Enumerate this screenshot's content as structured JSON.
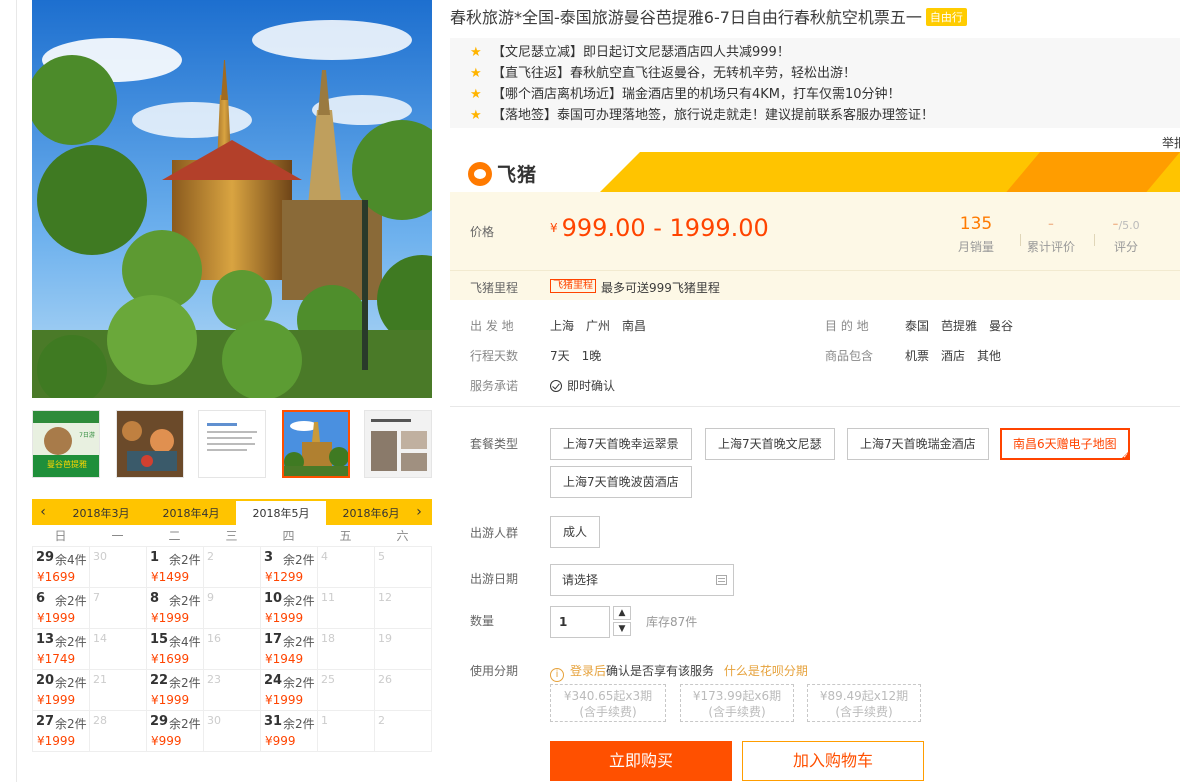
{
  "product": {
    "title": "春秋旅游*全国-泰国旅游曼谷芭提雅6-7日自由行春秋航空机票五一",
    "badge": "自由行"
  },
  "highlights": [
    "【文尼瑟立减】即日起订文尼瑟酒店四人共减999！",
    "【直飞往返】春秋航空直飞往返曼谷，无转机辛劳，轻松出游！",
    "【哪个酒店离机场近】瑞金酒店里的机场只有4KM，打车仅需10分钟！",
    "【落地签】泰国可办理落地签，旅行说走就走！建议提前联系客服办理签证！"
  ],
  "report_text": "举报",
  "brand": {
    "name": "飞猪",
    "colors": {
      "yellow": "#ffc400",
      "orange": "#ff9d00",
      "accent": "#ff5000"
    }
  },
  "price": {
    "label": "价格",
    "currency": "¥",
    "range": "999.00 - 1999.00"
  },
  "stats": [
    {
      "value": "135",
      "label": "月销量"
    },
    {
      "value": "-",
      "label": "累计评价"
    },
    {
      "value": "-",
      "suffix": "/5.0",
      "label": "评分"
    }
  ],
  "mileage": {
    "label": "飞猪里程",
    "tag": "飞猪里程",
    "text": "最多可送999飞猪里程"
  },
  "info": {
    "departure_label": "出 发 地",
    "departures": [
      "上海",
      "广州",
      "南昌"
    ],
    "destination_label": "目 的 地",
    "destinations": [
      "泰国",
      "芭提雅",
      "曼谷"
    ],
    "days_label": "行程天数",
    "days": [
      "7天",
      "1晚"
    ],
    "includes_label": "商品包含",
    "includes": [
      "机票",
      "酒店",
      "其他"
    ],
    "service_label": "服务承诺",
    "service": "即时确认"
  },
  "sku": {
    "package_label": "套餐类型",
    "packages": [
      "上海7天首晚幸运翠景",
      "上海7天首晚文尼瑟",
      "上海7天首晚瑞金酒店",
      "南昌6天赠电子地图",
      "上海7天首晚波茵酒店"
    ],
    "selected_index": 3,
    "crowd_label": "出游人群",
    "crowd": "成人",
    "date_label": "出游日期",
    "date_placeholder": "请选择",
    "qty_label": "数量",
    "qty": "1",
    "stock": "库存87件",
    "installment_label": "使用分期",
    "installment_login": "登录后",
    "installment_mid": "确认是否享有该服务",
    "installment_link": "什么是花呗分期",
    "installments": [
      {
        "line1": "¥340.65起x3期",
        "line2": "(含手续费)"
      },
      {
        "line1": "¥173.99起x6期",
        "line2": "(含手续费)"
      },
      {
        "line1": "¥89.49起x12期",
        "line2": "(含手续费)"
      }
    ],
    "buy": "立即购买",
    "cart": "加入购物车"
  },
  "calendar": {
    "prev": "‹",
    "next": "›",
    "months": [
      "2018年3月",
      "2018年4月",
      "2018年5月",
      "2018年6月"
    ],
    "active_month": 2,
    "weekdays": [
      "日",
      "一",
      "二",
      "三",
      "四",
      "五",
      "六"
    ],
    "cells": [
      {
        "d": "29",
        "s": "余4件",
        "p": "¥1699"
      },
      {
        "d": "30"
      },
      {
        "d": "1",
        "s": "余2件",
        "p": "¥1499"
      },
      {
        "d": "2"
      },
      {
        "d": "3",
        "s": "余2件",
        "p": "¥1299"
      },
      {
        "d": "4"
      },
      {
        "d": "5"
      },
      {
        "d": "6",
        "s": "余2件",
        "p": "¥1999"
      },
      {
        "d": "7"
      },
      {
        "d": "8",
        "s": "余2件",
        "p": "¥1999"
      },
      {
        "d": "9"
      },
      {
        "d": "10",
        "s": "余2件",
        "p": "¥1999"
      },
      {
        "d": "11"
      },
      {
        "d": "12"
      },
      {
        "d": "13",
        "s": "余2件",
        "p": "¥1749"
      },
      {
        "d": "14"
      },
      {
        "d": "15",
        "s": "余4件",
        "p": "¥1699"
      },
      {
        "d": "16"
      },
      {
        "d": "17",
        "s": "余2件",
        "p": "¥1949"
      },
      {
        "d": "18"
      },
      {
        "d": "19"
      },
      {
        "d": "20",
        "s": "余2件",
        "p": "¥1999"
      },
      {
        "d": "21"
      },
      {
        "d": "22",
        "s": "余2件",
        "p": "¥1999"
      },
      {
        "d": "23"
      },
      {
        "d": "24",
        "s": "余2件",
        "p": "¥1999"
      },
      {
        "d": "25"
      },
      {
        "d": "26"
      },
      {
        "d": "27",
        "s": "余2件",
        "p": "¥1999"
      },
      {
        "d": "28"
      },
      {
        "d": "29",
        "s": "余2件",
        "p": "¥999"
      },
      {
        "d": "30"
      },
      {
        "d": "31",
        "s": "余2件",
        "p": "¥999"
      },
      {
        "d": "1"
      },
      {
        "d": "2"
      }
    ]
  },
  "thumb_labels": {
    "t1_title": "曼谷芭提雅",
    "t1_sub": "7日游"
  }
}
